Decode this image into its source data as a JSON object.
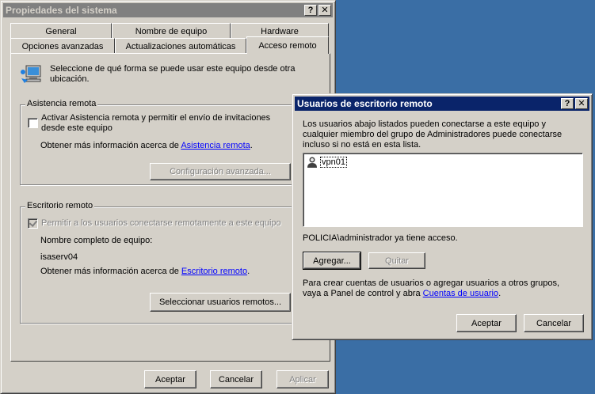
{
  "sys_window": {
    "title": "Propiedades del sistema",
    "help_btn": "?",
    "close_btn": "✕",
    "tabs_row1": [
      "General",
      "Nombre de equipo",
      "Hardware"
    ],
    "tabs_row2": [
      "Opciones avanzadas",
      "Actualizaciones automáticas",
      "Acceso remoto"
    ],
    "intro_text": "Seleccione de qué forma se puede usar este equipo desde otra ubicación.",
    "assist_group": {
      "label": "Asistencia remota",
      "checkbox_label": "Activar Asistencia remota y permitir el envío de invitaciones desde este equipo",
      "more_info_prefix": "Obtener más información acerca de ",
      "more_info_link": "Asistencia remota",
      "more_info_suffix": ".",
      "advanced_btn": "Configuración avanzada..."
    },
    "desktop_group": {
      "label": "Escritorio remoto",
      "checkbox_label": "Permitir a los usuarios conectarse remotamente a este equipo",
      "fullname_label": "Nombre completo de equipo:",
      "computer_name": "isaserv04",
      "more_info_prefix": "Obtener más información acerca de ",
      "more_info_link": "Escritorio remoto",
      "more_info_suffix": ".",
      "select_users_btn": "Seleccionar usuarios remotos..."
    },
    "ok_btn": "Aceptar",
    "cancel_btn": "Cancelar",
    "apply_btn": "Aplicar"
  },
  "rdu_dialog": {
    "title": "Usuarios de escritorio remoto",
    "help_btn": "?",
    "close_btn": "✕",
    "description": "Los usuarios abajo listados pueden conectarse a este equipo y cualquier miembro del grupo de Administradores puede conectarse incluso si no está en esta lista.",
    "users": [
      "vpn01"
    ],
    "access_note": "POLICIA\\administrador ya tiene acceso.",
    "add_btn": "Agregar...",
    "remove_btn": "Quitar",
    "footer_prefix": "Para crear cuentas de usuarios o agregar usuarios a otros grupos, vaya a Panel de control y abra ",
    "footer_link": "Cuentas de usuario",
    "footer_suffix": ".",
    "ok_btn": "Aceptar",
    "cancel_btn": "Cancelar"
  },
  "colors": {
    "desktop": "#3a6ea5",
    "active_title": "#0a246a",
    "inactive_title": "#808080",
    "face": "#d4d0c8"
  }
}
